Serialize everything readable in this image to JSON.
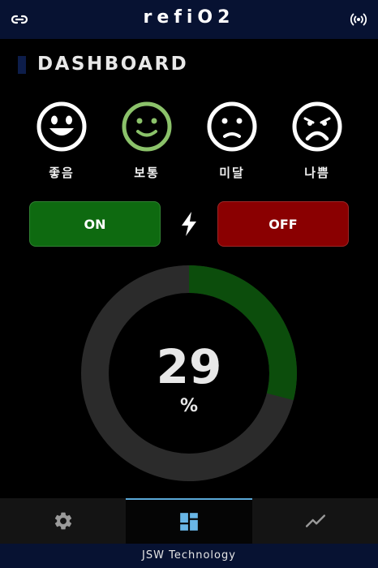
{
  "header": {
    "title": "refiO2",
    "link_icon": "link-icon",
    "status_icon": "wireless-antenna-icon"
  },
  "dashboard": {
    "title": "DASHBOARD"
  },
  "faces": [
    {
      "label": "좋음",
      "icon": "very-happy-face-icon",
      "color": "#ffffff"
    },
    {
      "label": "보통",
      "icon": "smile-face-icon",
      "color": "#8bc26a"
    },
    {
      "label": "미달",
      "icon": "sad-face-icon",
      "color": "#ffffff"
    },
    {
      "label": "나쁨",
      "icon": "very-sad-face-icon",
      "color": "#ffffff"
    }
  ],
  "controls": {
    "on_label": "ON",
    "off_label": "OFF",
    "on_color": "#0e6a10",
    "off_color": "#8a0001",
    "icon": "lightning-bolt-icon"
  },
  "gauge": {
    "value": "29",
    "unit": "%",
    "fraction": 0.29,
    "track_color": "#2b2b2b",
    "fill_color": "#0c4d0c"
  },
  "nav": {
    "items": [
      {
        "icon": "settings-gear-icon",
        "active": false
      },
      {
        "icon": "dashboard-grid-icon",
        "active": true
      },
      {
        "icon": "trend-chart-icon",
        "active": false
      }
    ]
  },
  "footer": {
    "text": "JSW Technology"
  }
}
